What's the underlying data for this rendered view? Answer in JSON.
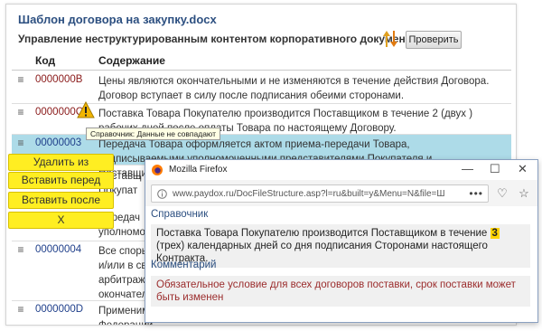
{
  "header": {
    "doc_title": "Шаблон договора на закупку.docx",
    "subtitle": "Управление неструктурированным контентом корпоративного документа",
    "sort_icon": "sort-arrows-icon",
    "check_button": "Проверить"
  },
  "table": {
    "columns": [
      "Код",
      "Содержание"
    ],
    "rows": [
      {
        "code": "0000000B",
        "content": "Цены являются окончательными и не изменяются в течение действия Договора. Договор вступает в силу после подписания обеими сторонами."
      },
      {
        "code": "0000000C",
        "content": "Поставка Товара Покупателю производится Поставщиком в течение 2 (двух ) рабочих дней после оплаты Товара по настоящему Договору."
      },
      {
        "code": "00000003",
        "content": "Передача Товара оформляется актом приема-передачи Товара, подписываемыми уполномоченными представителями Покупателя и Поставщика."
      },
      {
        "code": "",
        "content": "Поставщ"
      },
      {
        "code": "",
        "content": "Покупат"
      },
      {
        "code": "",
        "content": "Передач"
      },
      {
        "code": "",
        "content": "уполномо"
      },
      {
        "code": "00000004",
        "content": "Все споры, \nи/или в связ\nарбитражн\nокончатель"
      },
      {
        "code": "0000000D",
        "content": "Применимы\nФедерации"
      }
    ]
  },
  "warning": {
    "icon": "warning-icon",
    "tooltip": "Справочник: Данные не совпадают"
  },
  "context_menu": {
    "delete": "Удалить из документа",
    "insert_before": "Вставить перед",
    "insert_after": "Вставить после",
    "close": "X"
  },
  "popup": {
    "window_title": "Mozilla Firefox",
    "url": "www.paydox.ru/DocFileStructure.asp?l=ru&built=y&Menu=N&file=Ш",
    "url_more": "•••",
    "reference_label": "Справочник",
    "reference_text_before": "Поставка Товара Покупателю производится Поставщиком в течение",
    "reference_highlight": "3",
    "reference_text_after": "(трех) календарных дней со дня подписания Сторонами настоящего Контракта.",
    "comment_label": "Комментарий",
    "comment_text": "Обязательное условие для всех договоров поставки, срок поставки может быть изменен"
  },
  "colors": {
    "selected_row": "#addbe8",
    "code_red": "#8a1a1a",
    "code_blue": "#1f3f8a",
    "menu_yellow": "#ffee22",
    "highlight": "#ffd400",
    "comment_red": "#9b2c2c"
  }
}
